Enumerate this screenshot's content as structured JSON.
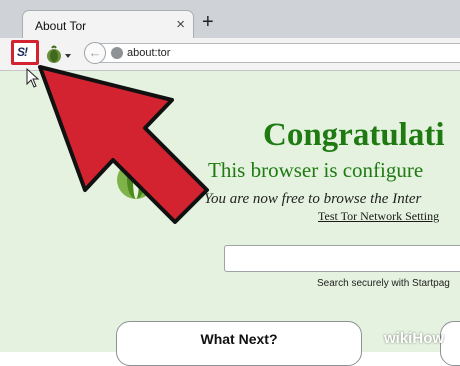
{
  "browser": {
    "tab_title": "About Tor",
    "tab_close": "×",
    "new_tab": "+",
    "url": "about:tor",
    "extension_label": "S!"
  },
  "page": {
    "heading": "Congratulati",
    "subheading": "This browser is configure",
    "free_text": "You are now free to browse the Inter",
    "test_link": "Test Tor Network Setting",
    "search_placeholder": "",
    "search_note": "Search securely with Startpag",
    "what_next": "What Next?"
  },
  "watermark": {
    "prefix": "wiki",
    "suffix": "How"
  },
  "colors": {
    "accent_red": "#d42330",
    "tor_green": "#1f7a12",
    "page_bg": "#e4f2df"
  },
  "icons": [
    "close-icon",
    "plus-icon",
    "extension-icon",
    "tor-onion-icon",
    "chevron-down-icon",
    "back-arrow-icon",
    "globe-icon",
    "mouse-cursor-icon",
    "red-arrow-annotation"
  ]
}
